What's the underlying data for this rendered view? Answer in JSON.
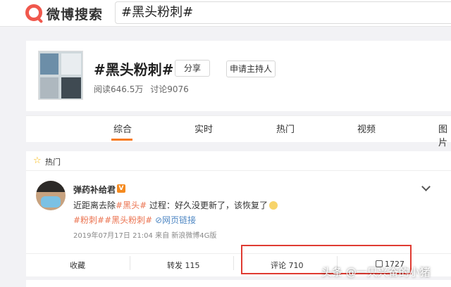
{
  "header": {
    "logo_text": "微博搜索",
    "search_query": "#黑头粉刺#"
  },
  "topic": {
    "title": "#黑头粉刺#",
    "share_label": "分享",
    "host_label": "申请主持人",
    "reads": "阅读646.5万",
    "discussions": "讨论9076"
  },
  "tabs": [
    {
      "label": "综合",
      "active": true
    },
    {
      "label": "实时"
    },
    {
      "label": "热门"
    },
    {
      "label": "视频"
    },
    {
      "label": "图片"
    }
  ],
  "feed": {
    "section_label": "热门",
    "post": {
      "user": "弹药补给君",
      "text_prefix": "近距离去除",
      "text_tag": "#黑头#",
      "text_suffix": " 过程：好久没更新了，该恢复了",
      "tag1": "#粉刺#",
      "tag2": "#黑头粉刺#",
      "web_link": "网页链接",
      "meta": "2019年07月17日 21:04  来自 新浪微博4G版"
    },
    "actions": {
      "collect": "收藏",
      "repost": "转发 115",
      "comment": "评论 710",
      "like": "1727"
    }
  },
  "watermark": "头条 @一只兴奋的小猪",
  "colors": {
    "accent": "#f77b23",
    "link_orange": "#eb7350",
    "link_blue": "#4f87c3",
    "highlight": "#e03b32"
  }
}
